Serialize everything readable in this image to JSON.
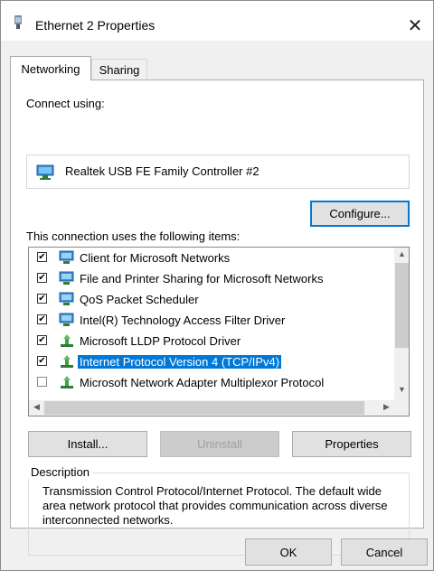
{
  "window": {
    "title": "Ethernet 2 Properties"
  },
  "tabs": [
    {
      "label": "Networking"
    },
    {
      "label": "Sharing"
    }
  ],
  "connect_using": {
    "label": "Connect using:",
    "adapter": "Realtek USB FE Family Controller #2"
  },
  "buttons": {
    "configure": "Configure...",
    "install": "Install...",
    "uninstall": "Uninstall",
    "properties": "Properties",
    "ok": "OK",
    "cancel": "Cancel"
  },
  "items_label": "This connection uses the following items:",
  "items": [
    {
      "label": "Client for Microsoft Networks",
      "checked": true,
      "icon": "network-client-icon",
      "selected": false
    },
    {
      "label": "File and Printer Sharing for Microsoft Networks",
      "checked": true,
      "icon": "network-service-icon",
      "selected": false
    },
    {
      "label": "QoS Packet Scheduler",
      "checked": true,
      "icon": "network-service-icon",
      "selected": false
    },
    {
      "label": "Intel(R) Technology Access Filter Driver",
      "checked": true,
      "icon": "network-service-icon",
      "selected": false
    },
    {
      "label": "Microsoft LLDP Protocol Driver",
      "checked": true,
      "icon": "protocol-icon",
      "selected": false
    },
    {
      "label": "Internet Protocol Version 4 (TCP/IPv4)",
      "checked": true,
      "icon": "protocol-icon",
      "selected": true
    },
    {
      "label": "Microsoft Network Adapter Multiplexor Protocol",
      "checked": false,
      "icon": "protocol-icon",
      "selected": false
    }
  ],
  "description": {
    "legend": "Description",
    "text": "Transmission Control Protocol/Internet Protocol. The default wide area network protocol that provides communication across diverse interconnected networks."
  },
  "colors": {
    "selection": "#0078d7",
    "focus_border": "#0078d7",
    "client_bg": "#f0f0f0"
  }
}
